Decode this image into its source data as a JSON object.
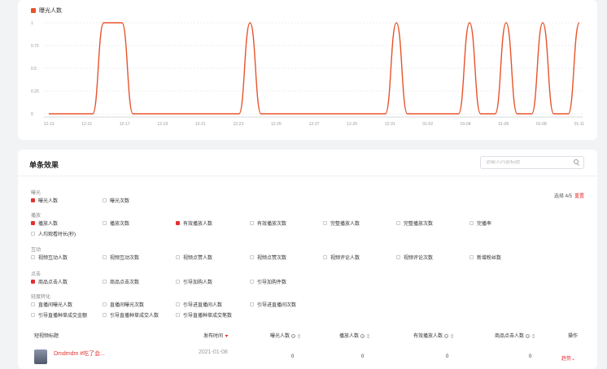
{
  "chart_data": {
    "type": "line",
    "legend": "曝光人数",
    "series": [
      {
        "name": "曝光人数",
        "color": "#e8532a"
      }
    ],
    "ylim": [
      0,
      1
    ],
    "yticks": [
      "0",
      "0.25",
      "0.5",
      "0.75",
      "1"
    ],
    "xticks": [
      "12-13",
      "12-15",
      "12-17",
      "12-19",
      "12-21",
      "12-23",
      "12-25",
      "12-27",
      "12-29",
      "12-31",
      "01-02",
      "01-04",
      "01-06",
      "01-08",
      "01-11"
    ],
    "points": [
      [
        0,
        0
      ],
      [
        2.4,
        0
      ],
      [
        3,
        1
      ],
      [
        4,
        1
      ],
      [
        4.6,
        0
      ],
      [
        10.4,
        0
      ],
      [
        11,
        1
      ],
      [
        11.6,
        0
      ],
      [
        18.4,
        0
      ],
      [
        19,
        1
      ],
      [
        19.6,
        0
      ],
      [
        22.4,
        0
      ],
      [
        23,
        1
      ],
      [
        23.6,
        0
      ],
      [
        24.4,
        0
      ],
      [
        25,
        1
      ],
      [
        25.6,
        0
      ],
      [
        26.4,
        0
      ],
      [
        27,
        1
      ],
      [
        27.6,
        0
      ],
      [
        28.4,
        0
      ],
      [
        29,
        1
      ]
    ],
    "xmax": 29
  },
  "effects": {
    "title": "单条效果",
    "search_placeholder": "请输入内容标题",
    "selection_text": "选择 4/5",
    "reset": "重置",
    "groups": [
      {
        "label": "曝光",
        "options": [
          {
            "label": "曝光人数",
            "checked": true
          },
          {
            "label": "曝光次数",
            "checked": false
          }
        ]
      },
      {
        "label": "播放",
        "options": [
          {
            "label": "播放人数",
            "checked": true
          },
          {
            "label": "播放次数",
            "checked": false
          },
          {
            "label": "有效播放人数",
            "checked": true
          },
          {
            "label": "有效播放次数",
            "checked": false
          },
          {
            "label": "完整播放人数",
            "checked": false
          },
          {
            "label": "完整播放次数",
            "checked": false
          },
          {
            "label": "完播率",
            "checked": false
          },
          {
            "label": "人均观看时长(秒)",
            "checked": false
          }
        ]
      },
      {
        "label": "互动",
        "options": [
          {
            "label": "视频互动人数",
            "checked": false
          },
          {
            "label": "视频互动次数",
            "checked": false
          },
          {
            "label": "视频点赞人数",
            "checked": false
          },
          {
            "label": "视频点赞次数",
            "checked": false
          },
          {
            "label": "视频评论人数",
            "checked": false
          },
          {
            "label": "视频评论次数",
            "checked": false
          },
          {
            "label": "新增粉丝数",
            "checked": false
          }
        ]
      },
      {
        "label": "点击",
        "options": [
          {
            "label": "商品点击人数",
            "checked": true
          },
          {
            "label": "商品点击次数",
            "checked": false
          },
          {
            "label": "引导加购人数",
            "checked": false
          },
          {
            "label": "引导加购件数",
            "checked": false
          }
        ]
      },
      {
        "label": "轻度转化",
        "options": [
          {
            "label": "直播间曝光人数",
            "checked": false
          },
          {
            "label": "直播间曝光次数",
            "checked": false
          },
          {
            "label": "引导进直播间人数",
            "checked": false
          },
          {
            "label": "引导进直播间次数",
            "checked": false
          },
          {
            "label": "引导直播种草成交金额",
            "checked": false
          },
          {
            "label": "引导直播种草成交人数",
            "checked": false
          },
          {
            "label": "引导直播种草成交笔数",
            "checked": false
          }
        ]
      }
    ],
    "table": {
      "headers": {
        "title": "短视频标题",
        "date": "发布时间",
        "exposure": "曝光人数",
        "play": "播放人数",
        "valid_play": "有效播放人数",
        "click": "商品点击人数",
        "action": "操作"
      },
      "rows": [
        {
          "title": "Dmdmdm #吃了会...",
          "date": "2021-01-08",
          "exposure": "0",
          "play": "0",
          "valid_play": "0",
          "click": "0",
          "action": "趋势"
        }
      ]
    }
  }
}
